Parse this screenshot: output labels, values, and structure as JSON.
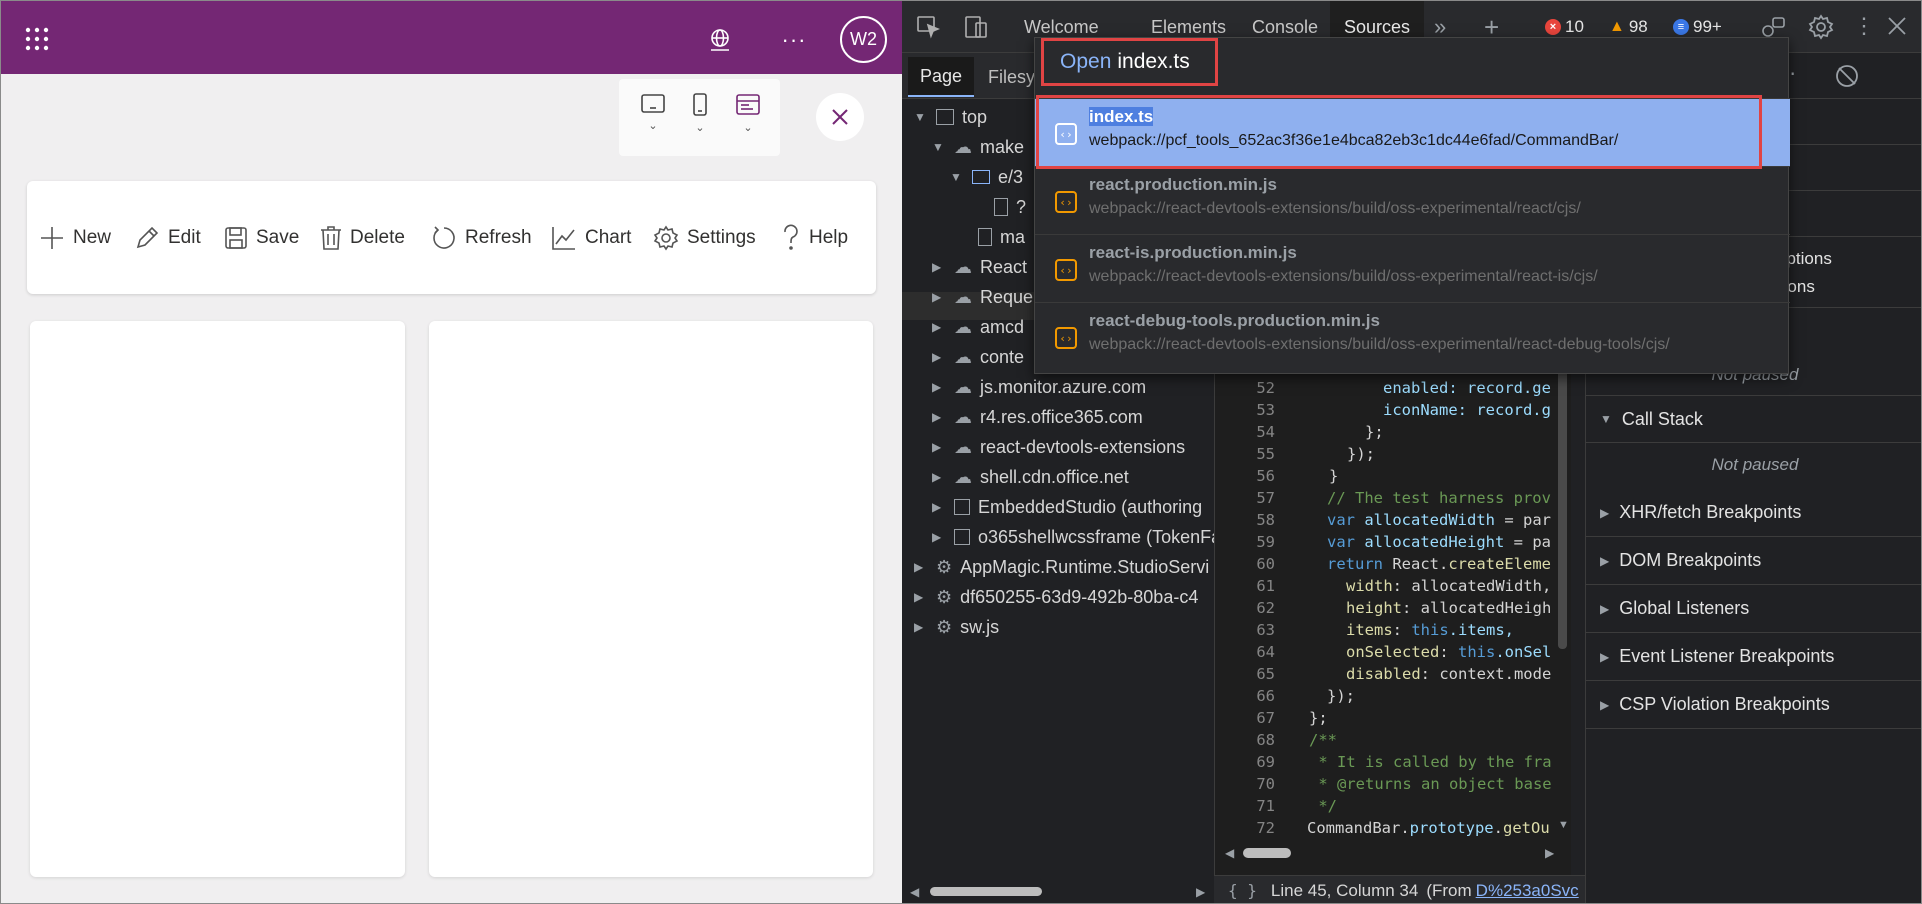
{
  "app": {
    "avatar_initials": "W2",
    "commands": [
      {
        "label": "New",
        "icon": "plus-icon"
      },
      {
        "label": "Edit",
        "icon": "pencil-icon"
      },
      {
        "label": "Save",
        "icon": "save-icon"
      },
      {
        "label": "Delete",
        "icon": "trash-icon"
      },
      {
        "label": "Refresh",
        "icon": "refresh-icon"
      },
      {
        "label": "Chart",
        "icon": "chart-icon"
      },
      {
        "label": "Settings",
        "icon": "gear-icon"
      },
      {
        "label": "Help",
        "icon": "question-icon"
      }
    ],
    "colors": {
      "header": "#742774",
      "background": "#f0eff0"
    }
  },
  "devtools": {
    "tabs": {
      "welcome": "Welcome",
      "elements": "Elements",
      "console": "Console",
      "sources": "Sources"
    },
    "badges": {
      "errors": "10",
      "warnings": "98",
      "issues": "99+"
    },
    "nav_tabs": {
      "page": "Page",
      "filesystem": "Filesys"
    },
    "tree": {
      "top": "top",
      "make": "make",
      "folder": "e/3",
      "selected": "?",
      "ma": "ma",
      "react": "React",
      "reque": "Reque",
      "amcd": "amcd",
      "conte": "conte",
      "d1": "js.monitor.azure.com",
      "d2": "r4.res.office365.com",
      "d3": "react-devtools-extensions",
      "d4": "shell.cdn.office.net",
      "f1": "EmbeddedStudio (authoring",
      "f2": "o365shellwcssframe (TokenFa",
      "w1": "AppMagic.Runtime.StudioServi",
      "w2": "df650255-63d9-492b-80ba-c4",
      "w3": "sw.js"
    },
    "code": {
      "l52": "52",
      "c52": "enabled: record.ge",
      "l53": "53",
      "c53": "iconName: record.g",
      "l54": "54",
      "c54": "};",
      "l55": "55",
      "c55": "});",
      "l56": "56",
      "c56": "}",
      "l57": "57",
      "c57": "// The test harness prov",
      "l58": "58",
      "c58a": "var",
      "c58b": "allocatedWidth",
      "c58c": " = par",
      "l59": "59",
      "c59a": "var",
      "c59b": "allocatedHeight",
      "c59c": " = pa",
      "l60": "60",
      "c60a": "return",
      "c60b": " React.",
      "c60c": "createEleme",
      "l61": "61",
      "c61a": "width",
      "c61b": ": allocatedWidth,",
      "l62": "62",
      "c62a": "height",
      "c62b": ": allocatedHeigh",
      "l63": "63",
      "c63a": "items",
      "c63b": ": ",
      "c63c": "this",
      "c63d": ".items,",
      "l64": "64",
      "c64a": "onSelected",
      "c64b": ": ",
      "c64c": "this",
      "c64d": ".onSel",
      "l65": "65",
      "c65a": "disabled",
      "c65b": ": context.mode",
      "l66": "66",
      "c66": "});",
      "l67": "67",
      "c67": "};",
      "l68": "68",
      "c68": "/**",
      "l69": "69",
      "c69": " * It is called by the fra",
      "l70": "70",
      "c70": " * @returns an object base",
      "l71": "71",
      "c71": " */",
      "l72": "72",
      "c72a": "CommandBar.",
      "c72b": "prototype",
      "c72c": ".",
      "c72d": "getOu"
    },
    "status": {
      "position": "Line 45, Column 34",
      "from": "(From",
      "link": "D%253a0Svc"
    },
    "right_pane": {
      "exc1": "xceptions",
      "exc2": "eptions",
      "not_paused": "Not paused",
      "call_stack": "Call Stack",
      "not_paused2": "Not paused",
      "s1": "XHR/fetch Breakpoints",
      "s2": "DOM Breakpoints",
      "s3": "Global Listeners",
      "s4": "Event Listener Breakpoints",
      "s5": "CSP Violation Breakpoints"
    },
    "quick_open": {
      "prefix": "Open",
      "query": "index.ts",
      "items": [
        {
          "name": "index.ts",
          "path": "webpack://pcf_tools_652ac3f36e1e4bca82eb3c1dc44e6fad/CommandBar/"
        },
        {
          "name": "react.production.min.js",
          "path": "webpack://react-devtools-extensions/build/oss-experimental/react/cjs/"
        },
        {
          "name": "react-is.production.min.js",
          "path": "webpack://react-devtools-extensions/build/oss-experimental/react-is/cjs/"
        },
        {
          "name": "react-debug-tools.production.min.js",
          "path": "webpack://react-devtools-extensions/build/oss-experimental/react-debug-tools/cjs/"
        }
      ]
    }
  }
}
